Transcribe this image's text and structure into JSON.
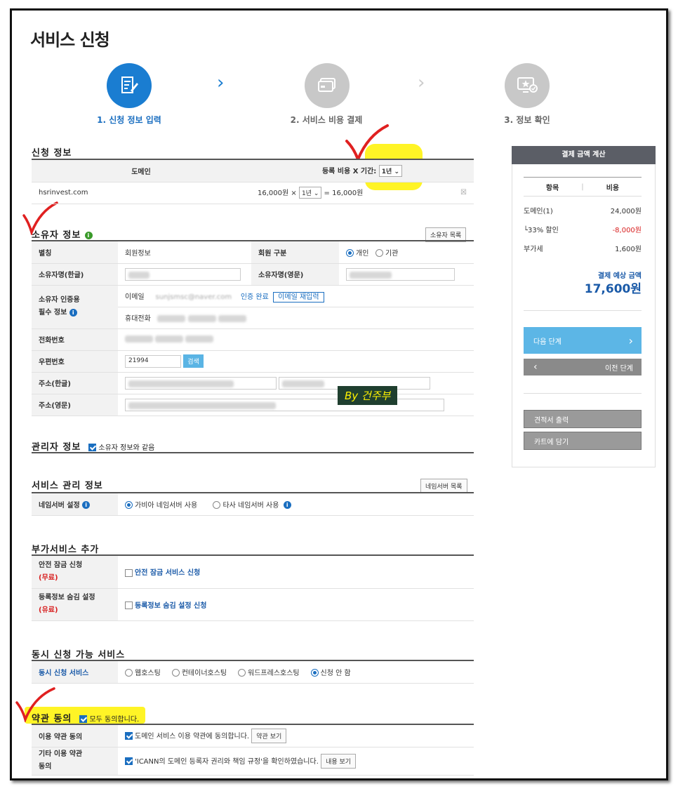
{
  "page_title": "서비스 신청",
  "steps": [
    {
      "label": "1. 신청 정보 입력",
      "state": "active",
      "icon": "form-edit-icon"
    },
    {
      "label": "2. 서비스 비용 결제",
      "state": "inactive",
      "icon": "payment-card-icon"
    },
    {
      "label": "3. 정보 확인",
      "state": "inactive",
      "icon": "monitor-check-icon"
    }
  ],
  "application": {
    "title": "신청 정보",
    "col_domain": "도메인",
    "col_fee": "등록 비용 X 기간:",
    "period_select": "1년",
    "domain": "hsrinvest.com",
    "fee_unit": "16,000원 ×",
    "fee_period": "1년",
    "fee_total": "= 16,000원",
    "remove_icon": "☒"
  },
  "owner": {
    "title": "소유자 정보",
    "list_button": "소유자 목록",
    "alias_label": "별칭",
    "alias_value": "회원정보",
    "member_type_label": "회원 구분",
    "member_type_options": [
      "개인",
      "기관"
    ],
    "member_type_selected": "개인",
    "name_ko_label": "소유자명(한글)",
    "name_en_label": "소유자명(영문)",
    "auth_label_1": "소유자 인증용",
    "auth_label_2": "필수 정보",
    "email_label": "이메일",
    "email_value": "sunjsmsc@naver.com",
    "auth_done": "인증 완료",
    "email_reenter_button": "이메일 재입력",
    "mobile_label": "휴대전화",
    "phone_label": "전화번호",
    "zip_label": "우편번호",
    "zip_value": "21994",
    "zip_search_button": "검색",
    "addr_ko_label": "주소(한글)",
    "addr_en_label": "주소(영문)"
  },
  "watermark": "By 건주부",
  "admin": {
    "title": "관리자 정보",
    "same_as_owner": "소유자 정보와 같음"
  },
  "service": {
    "title": "서비스 관리 정보",
    "ns_list_button": "네임서버 목록",
    "ns_label": "네임서버 설정",
    "ns_option_1": "가비아 네임서버 사용",
    "ns_option_2": "타사 네임서버 사용"
  },
  "addons": {
    "title": "부가서비스 추가",
    "lock_label": "안전 잠금 신청",
    "lock_price": "(무료)",
    "lock_option": "안전 잠금 서비스 신청",
    "hide_label": "등록정보 숨김 설정",
    "hide_price": "(유료)",
    "hide_option": "등록정보 숨김 설정 신청"
  },
  "bundle": {
    "title": "동시 신청 가능 서비스",
    "label": "동시 신청 서비스",
    "options": [
      "웹호스팅",
      "컨테이너호스팅",
      "워드프레스호스팅",
      "신청 안 함"
    ],
    "selected": "신청 안 함"
  },
  "terms": {
    "title": "약관 동의",
    "agree_all": "모두 동의합니다.",
    "row1_label": "이용 약관 동의",
    "row1_text": "도메인 서비스 이용 약관에 동의합니다.",
    "row1_button": "약관 보기",
    "row2_label_1": "기타 이용 약관",
    "row2_label_2": "동의",
    "row2_text": "'ICANN의 도메인 등록자 권리와 책임 규정'을 확인하였습니다.",
    "row2_button": "내용 보기"
  },
  "sidebar": {
    "title": "결제 금액 계산",
    "col_item": "항목",
    "col_cost": "비용",
    "rows": [
      {
        "item": "도메인(1)",
        "cost": "24,000원"
      },
      {
        "item": "└33% 할인",
        "cost": "-8,000원"
      },
      {
        "item": "부가세",
        "cost": "1,600원"
      }
    ],
    "total_label": "결제 예상 금액",
    "total_value": "17,600원",
    "next_button": "다음 단계",
    "prev_button": "이전 단계",
    "quote_button": "견적서 출력",
    "cart_button": "카트에 담기"
  },
  "colors": {
    "accent": "#1a7dd1",
    "highlight": "#fff200",
    "check_mark": "#e02020"
  }
}
